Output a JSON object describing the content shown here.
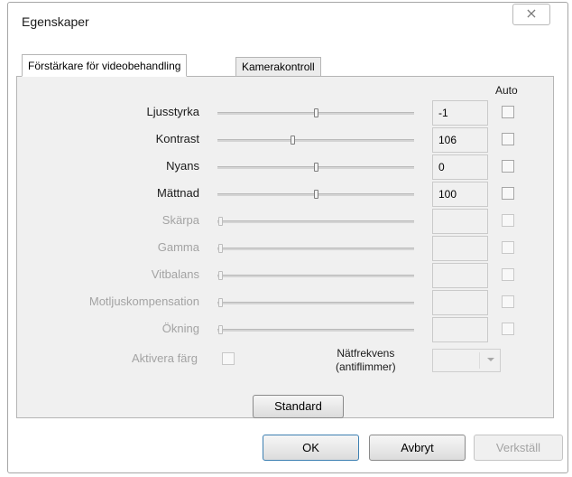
{
  "window": {
    "title": "Egenskaper",
    "close_glyph": "⨯"
  },
  "tabs": [
    {
      "label": "Förstärkare för videobehandling",
      "active": true
    },
    {
      "label": "Kamerakontroll",
      "active": false
    }
  ],
  "auto_header": "Auto",
  "rows": [
    {
      "label": "Ljusstyrka",
      "value": "-1",
      "enabled": true,
      "level": 0.5
    },
    {
      "label": "Kontrast",
      "value": "106",
      "enabled": true,
      "level": 0.375
    },
    {
      "label": "Nyans",
      "value": "0",
      "enabled": true,
      "level": 0.5
    },
    {
      "label": "Mättnad",
      "value": "100",
      "enabled": true,
      "level": 0.5
    },
    {
      "label": "Skärpa",
      "value": "",
      "enabled": false,
      "level": 0
    },
    {
      "label": "Gamma",
      "value": "",
      "enabled": false,
      "level": 0
    },
    {
      "label": "Vitbalans",
      "value": "",
      "enabled": false,
      "level": 0
    },
    {
      "label": "Motljuskompensation",
      "value": "",
      "enabled": false,
      "level": 0
    },
    {
      "label": "Ökning",
      "value": "",
      "enabled": false,
      "level": 0
    }
  ],
  "color_enable": {
    "label": "Aktivera färg"
  },
  "power_freq": {
    "label_line1": "Nätfrekvens",
    "label_line2": "(antiflimmer)",
    "value": ""
  },
  "buttons": {
    "default": "Standard",
    "ok": "OK",
    "cancel": "Avbryt",
    "apply": "Verkställ"
  }
}
